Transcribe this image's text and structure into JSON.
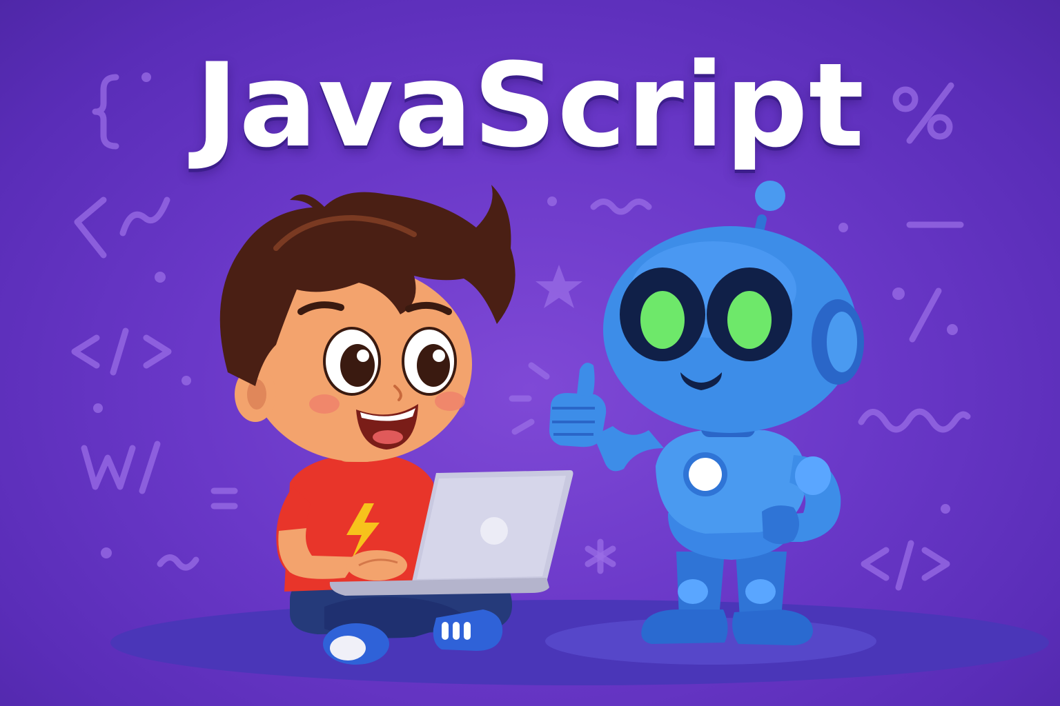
{
  "title": "JavaScript",
  "colors": {
    "background": "#6a38c8",
    "title": "#ffffff",
    "boy_shirt": "#e8352a",
    "boy_hair": "#4a1f14",
    "robot_body": "#3d8de8",
    "robot_eyes": "#6ee86a",
    "laptop": "#c9c9e0"
  },
  "icons": [
    "curly-brace-icon",
    "code-tag-icon",
    "percent-icon",
    "star-icon",
    "wave-icon",
    "lightning-bolt-icon"
  ]
}
